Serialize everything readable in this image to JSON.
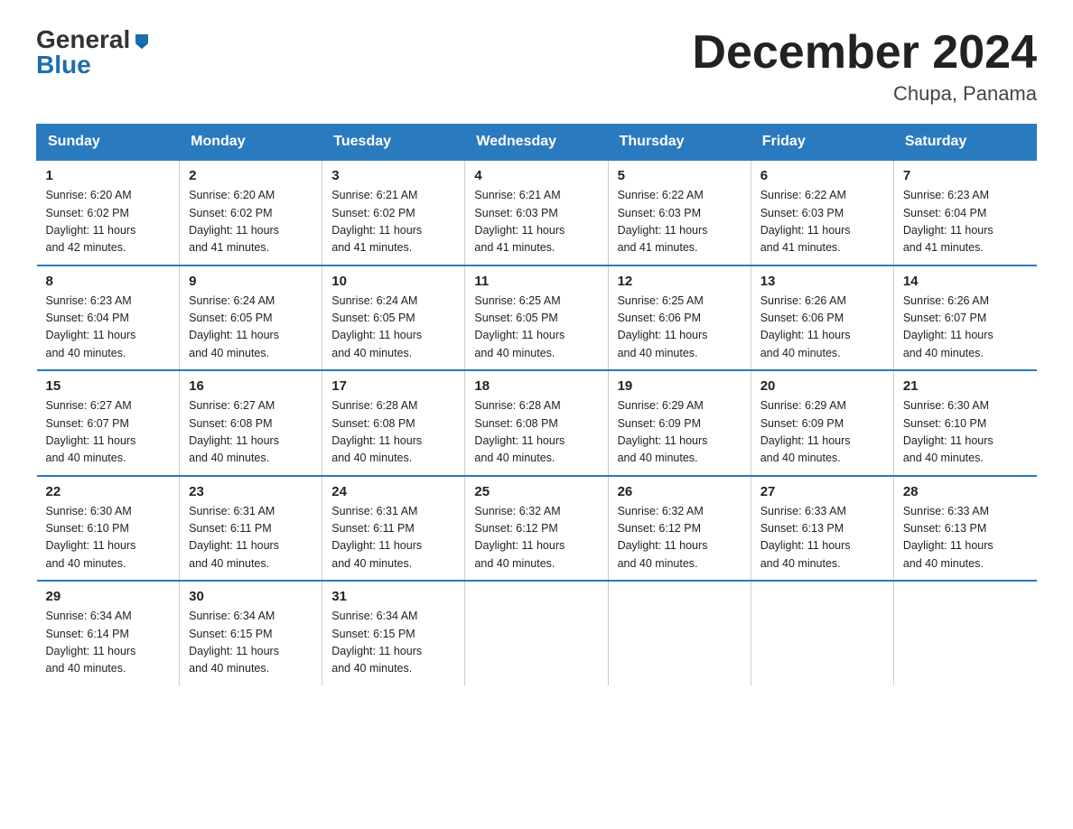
{
  "logo": {
    "general": "General",
    "blue": "Blue",
    "arrow": "▶"
  },
  "title": "December 2024",
  "location": "Chupa, Panama",
  "headers": [
    "Sunday",
    "Monday",
    "Tuesday",
    "Wednesday",
    "Thursday",
    "Friday",
    "Saturday"
  ],
  "weeks": [
    [
      {
        "day": "1",
        "sunrise": "6:20 AM",
        "sunset": "6:02 PM",
        "daylight": "11 hours and 42 minutes."
      },
      {
        "day": "2",
        "sunrise": "6:20 AM",
        "sunset": "6:02 PM",
        "daylight": "11 hours and 41 minutes."
      },
      {
        "day": "3",
        "sunrise": "6:21 AM",
        "sunset": "6:02 PM",
        "daylight": "11 hours and 41 minutes."
      },
      {
        "day": "4",
        "sunrise": "6:21 AM",
        "sunset": "6:03 PM",
        "daylight": "11 hours and 41 minutes."
      },
      {
        "day": "5",
        "sunrise": "6:22 AM",
        "sunset": "6:03 PM",
        "daylight": "11 hours and 41 minutes."
      },
      {
        "day": "6",
        "sunrise": "6:22 AM",
        "sunset": "6:03 PM",
        "daylight": "11 hours and 41 minutes."
      },
      {
        "day": "7",
        "sunrise": "6:23 AM",
        "sunset": "6:04 PM",
        "daylight": "11 hours and 41 minutes."
      }
    ],
    [
      {
        "day": "8",
        "sunrise": "6:23 AM",
        "sunset": "6:04 PM",
        "daylight": "11 hours and 40 minutes."
      },
      {
        "day": "9",
        "sunrise": "6:24 AM",
        "sunset": "6:05 PM",
        "daylight": "11 hours and 40 minutes."
      },
      {
        "day": "10",
        "sunrise": "6:24 AM",
        "sunset": "6:05 PM",
        "daylight": "11 hours and 40 minutes."
      },
      {
        "day": "11",
        "sunrise": "6:25 AM",
        "sunset": "6:05 PM",
        "daylight": "11 hours and 40 minutes."
      },
      {
        "day": "12",
        "sunrise": "6:25 AM",
        "sunset": "6:06 PM",
        "daylight": "11 hours and 40 minutes."
      },
      {
        "day": "13",
        "sunrise": "6:26 AM",
        "sunset": "6:06 PM",
        "daylight": "11 hours and 40 minutes."
      },
      {
        "day": "14",
        "sunrise": "6:26 AM",
        "sunset": "6:07 PM",
        "daylight": "11 hours and 40 minutes."
      }
    ],
    [
      {
        "day": "15",
        "sunrise": "6:27 AM",
        "sunset": "6:07 PM",
        "daylight": "11 hours and 40 minutes."
      },
      {
        "day": "16",
        "sunrise": "6:27 AM",
        "sunset": "6:08 PM",
        "daylight": "11 hours and 40 minutes."
      },
      {
        "day": "17",
        "sunrise": "6:28 AM",
        "sunset": "6:08 PM",
        "daylight": "11 hours and 40 minutes."
      },
      {
        "day": "18",
        "sunrise": "6:28 AM",
        "sunset": "6:08 PM",
        "daylight": "11 hours and 40 minutes."
      },
      {
        "day": "19",
        "sunrise": "6:29 AM",
        "sunset": "6:09 PM",
        "daylight": "11 hours and 40 minutes."
      },
      {
        "day": "20",
        "sunrise": "6:29 AM",
        "sunset": "6:09 PM",
        "daylight": "11 hours and 40 minutes."
      },
      {
        "day": "21",
        "sunrise": "6:30 AM",
        "sunset": "6:10 PM",
        "daylight": "11 hours and 40 minutes."
      }
    ],
    [
      {
        "day": "22",
        "sunrise": "6:30 AM",
        "sunset": "6:10 PM",
        "daylight": "11 hours and 40 minutes."
      },
      {
        "day": "23",
        "sunrise": "6:31 AM",
        "sunset": "6:11 PM",
        "daylight": "11 hours and 40 minutes."
      },
      {
        "day": "24",
        "sunrise": "6:31 AM",
        "sunset": "6:11 PM",
        "daylight": "11 hours and 40 minutes."
      },
      {
        "day": "25",
        "sunrise": "6:32 AM",
        "sunset": "6:12 PM",
        "daylight": "11 hours and 40 minutes."
      },
      {
        "day": "26",
        "sunrise": "6:32 AM",
        "sunset": "6:12 PM",
        "daylight": "11 hours and 40 minutes."
      },
      {
        "day": "27",
        "sunrise": "6:33 AM",
        "sunset": "6:13 PM",
        "daylight": "11 hours and 40 minutes."
      },
      {
        "day": "28",
        "sunrise": "6:33 AM",
        "sunset": "6:13 PM",
        "daylight": "11 hours and 40 minutes."
      }
    ],
    [
      {
        "day": "29",
        "sunrise": "6:34 AM",
        "sunset": "6:14 PM",
        "daylight": "11 hours and 40 minutes."
      },
      {
        "day": "30",
        "sunrise": "6:34 AM",
        "sunset": "6:15 PM",
        "daylight": "11 hours and 40 minutes."
      },
      {
        "day": "31",
        "sunrise": "6:34 AM",
        "sunset": "6:15 PM",
        "daylight": "11 hours and 40 minutes."
      },
      null,
      null,
      null,
      null
    ]
  ],
  "labels": {
    "sunrise": "Sunrise:",
    "sunset": "Sunset:",
    "daylight": "Daylight:"
  }
}
